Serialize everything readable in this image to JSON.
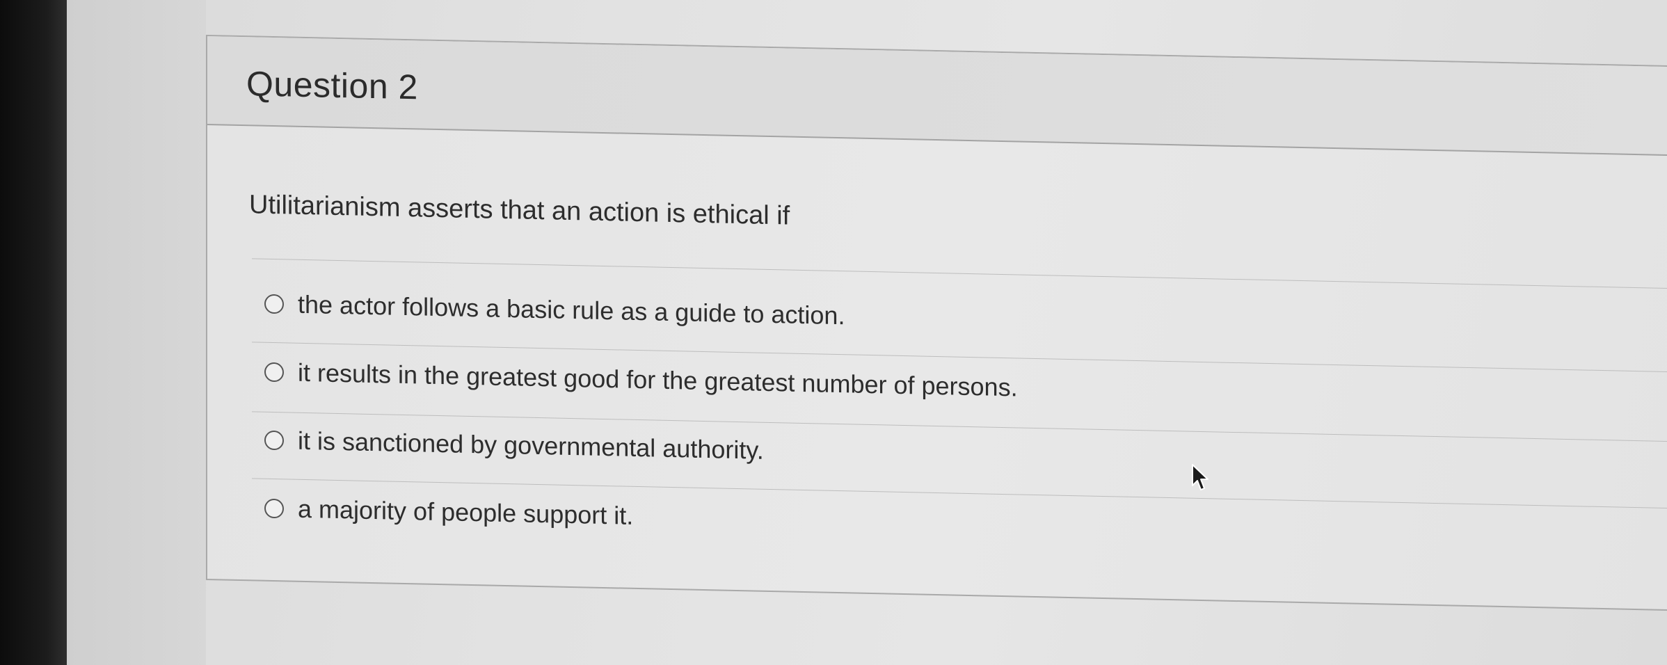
{
  "question": {
    "title": "Question 2",
    "prompt": "Utilitarianism asserts that an action is ethical if",
    "options": [
      {
        "label": "the actor follows a basic rule as a guide to action.",
        "selected": false
      },
      {
        "label": "it results in the greatest good for the greatest number of persons.",
        "selected": false
      },
      {
        "label": "it is sanctioned by governmental authority.",
        "selected": false
      },
      {
        "label": "a majority of people support it.",
        "selected": false
      }
    ]
  },
  "icons": {
    "cursor": "mouse-pointer-icon",
    "radio": "radio-button-icon"
  },
  "colors": {
    "text": "#2d2d2d",
    "border": "#a9a9a9",
    "background": "#e4e4e4"
  }
}
